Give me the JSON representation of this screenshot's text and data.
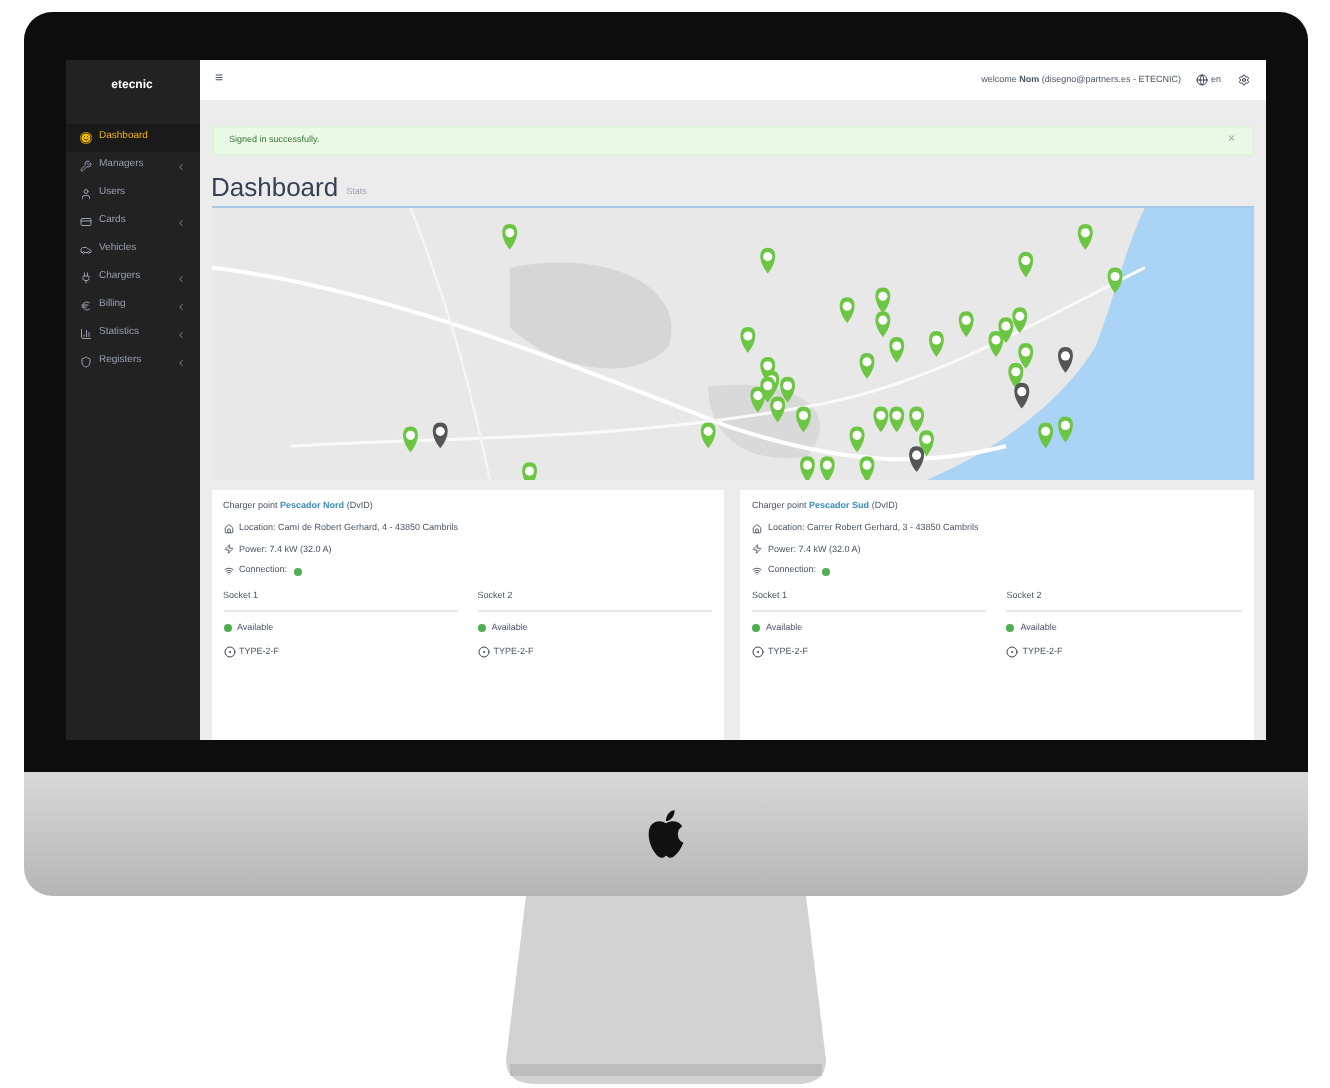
{
  "sidebar": {
    "logo": "etecnic",
    "items": [
      {
        "label": "Dashboard",
        "selected": true,
        "expandable": false
      },
      {
        "label": "Managers",
        "selected": false,
        "expandable": true
      },
      {
        "label": "Users",
        "selected": false,
        "expandable": false
      },
      {
        "label": "Cards",
        "selected": false,
        "expandable": true
      },
      {
        "label": "Vehicles",
        "selected": false,
        "expandable": false
      },
      {
        "label": "Chargers",
        "selected": false,
        "expandable": true
      },
      {
        "label": "Billing",
        "selected": false,
        "expandable": true
      },
      {
        "label": "Statistics",
        "selected": false,
        "expandable": true
      },
      {
        "label": "Registers",
        "selected": false,
        "expandable": true
      }
    ]
  },
  "header": {
    "menu": "≡",
    "welcome": "welcome **Nom** (disegno@partners.es - ETECNIC)",
    "language": "en"
  },
  "alert": {
    "message": "Signed in successfully.",
    "close": "×"
  },
  "page": {
    "title": "Dashboard",
    "subtitle": "Stats"
  },
  "chargers": [
    {
      "prefix": "Charger point",
      "name": "Pescador Nord",
      "code": "(DvID)",
      "location": "Location: Camí de Robert Gerhard, 4 - 43850 Cambrils",
      "power": "Power: 7.4 kW (32.0 A)",
      "connection": {
        "label": "Connection:",
        "color": "#4caf50"
      },
      "sockets": [
        {
          "title": "Socket 1",
          "status": "Available",
          "color": "#4caf50",
          "type": "TYPE-2-F"
        },
        {
          "title": "Socket 2",
          "status": "Available",
          "color": "#4caf50",
          "type": "TYPE-2-F"
        }
      ]
    },
    {
      "prefix": "Charger point",
      "name": "Pescador Sud",
      "code": "(DvID)",
      "location": "Location: Carrer Robert Gerhard, 3 - 43850 Cambrils",
      "power": "Power: 7.4 kW (32.0 A)",
      "connection": {
        "label": "Connection:",
        "color": "#4caf50"
      },
      "sockets": [
        {
          "title": "Socket 1",
          "status": "Available",
          "color": "#4caf50",
          "type": "TYPE-2-F"
        },
        {
          "title": "Socket 2",
          "status": "Available",
          "color": "#4caf50",
          "type": "TYPE-2-F"
        }
      ]
    }
  ]
}
